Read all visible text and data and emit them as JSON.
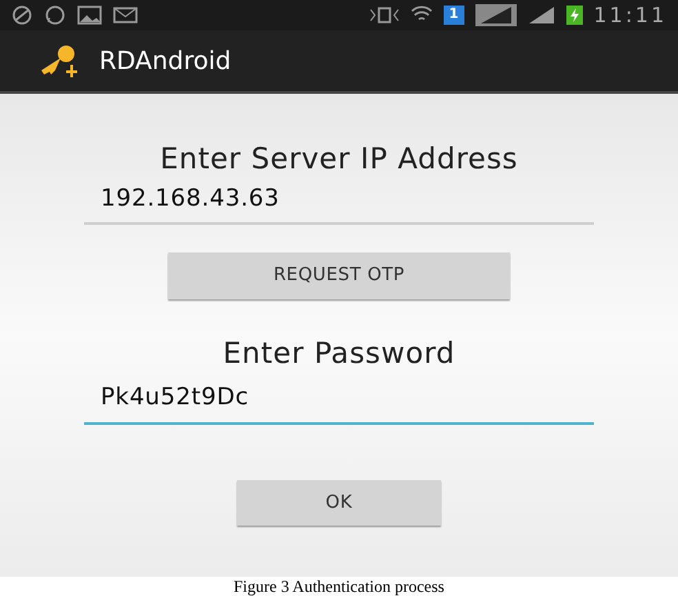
{
  "status_bar": {
    "time": "11:11",
    "notification_count": "1"
  },
  "action_bar": {
    "title": "RDAndroid"
  },
  "form": [
    {
      "kind": "label",
      "text": "Enter Server IP Address"
    },
    {
      "kind": "field",
      "value": "192.168.43.63",
      "focused": false
    },
    {
      "kind": "button",
      "text": "REQUEST OTP",
      "wide": true
    },
    {
      "kind": "label",
      "text": "Enter Password"
    },
    {
      "kind": "field",
      "value": "Pk4u52t9Dc",
      "focused": true
    },
    {
      "kind": "button",
      "text": "OK",
      "wide": false
    }
  ],
  "caption": "Figure 3 Authentication process"
}
